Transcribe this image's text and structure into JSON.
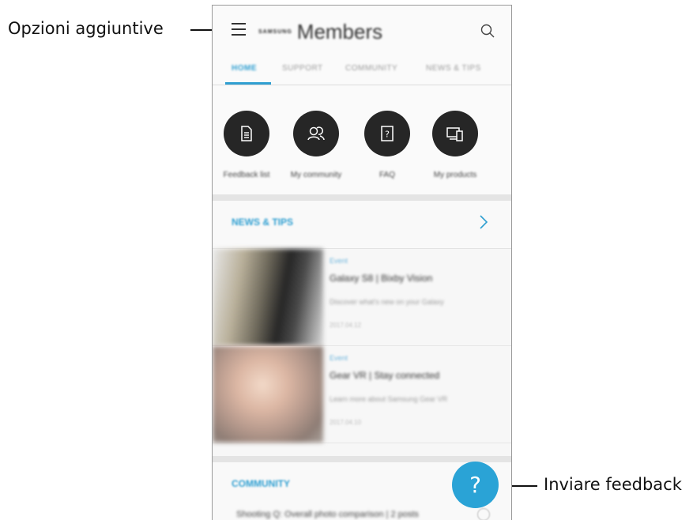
{
  "callouts": {
    "options_label": "Opzioni aggiuntive",
    "feedback_label": "Inviare feedback"
  },
  "app": {
    "brand_small": "SAMSUNG",
    "brand_big": "Members",
    "menu_icon": "hamburger-menu-icon",
    "search_icon": "search-icon"
  },
  "tabs": [
    {
      "label": "HOME",
      "active": true
    },
    {
      "label": "SUPPORT",
      "active": false
    },
    {
      "label": "COMMUNITY",
      "active": false
    },
    {
      "label": "NEWS & TIPS",
      "active": false
    }
  ],
  "shortcuts": [
    {
      "label": "Feedback list",
      "icon": "document-icon"
    },
    {
      "label": "My community",
      "icon": "people-icon"
    },
    {
      "label": "FAQ",
      "icon": "faq-icon"
    },
    {
      "label": "My products",
      "icon": "devices-icon"
    }
  ],
  "news": {
    "title": "NEWS & TIPS",
    "articles": [
      {
        "tag": "Event",
        "headline": "Galaxy S8 | Bixby Vision",
        "desc": "Discover what's new on your Galaxy",
        "meta": "2017.04.12"
      },
      {
        "tag": "Event",
        "headline": "Gear VR | Stay connected",
        "desc": "Learn more about Samsung Gear VR",
        "meta": "2017.04.10"
      }
    ]
  },
  "community": {
    "title": "COMMUNITY",
    "post": "Shooting Q: Overall photo comparison | 2 posts"
  },
  "fab": {
    "symbol": "?"
  },
  "colors": {
    "accent": "#2f9fd1",
    "fab": "#2aa3d6",
    "shortcut_circle": "#262626"
  }
}
